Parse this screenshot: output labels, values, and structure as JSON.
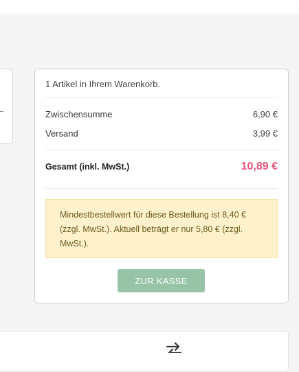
{
  "cart": {
    "item_count_text": "1 Artikel in Ihrem Warenkorb.",
    "subtotal_label": "Zwischensumme",
    "subtotal_value": "6,90 €",
    "shipping_label": "Versand",
    "shipping_value": "3,99 €",
    "total_label": "Gesamt (inkl. MwSt.)",
    "total_value": "10,89 €",
    "minimum_order_notice": "Mindestbestellwert für diese Bestellung ist 8,40 € (zzgl. MwSt.). Aktuell beträgt er nur 5,80 € (zzgl. MwSt.).",
    "checkout_button_label": "ZUR KASSE"
  },
  "icons": {
    "bottom_card_icon": "swap-arrows-icon"
  },
  "colors": {
    "total_price": "#e8557c",
    "checkout_button": "#97c4a7",
    "notice_background": "#fdf2cc",
    "notice_text": "#6b5b1a"
  }
}
